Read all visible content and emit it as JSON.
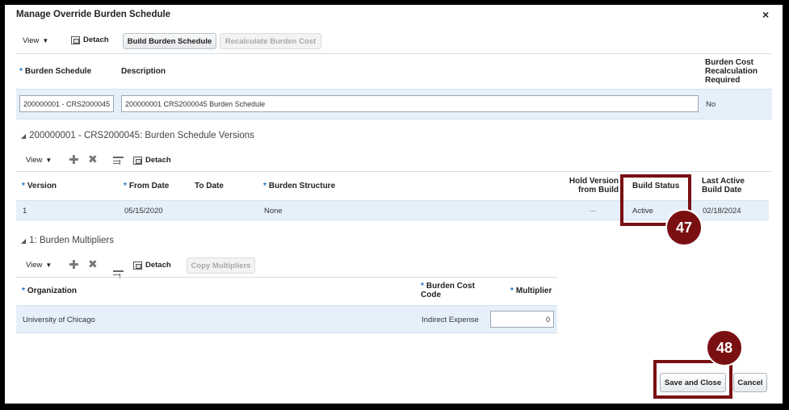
{
  "dialog": {
    "title": "Manage Override Burden Schedule",
    "close_glyph": "×"
  },
  "toolbar": {
    "view_label": "View",
    "detach_label": "Detach",
    "build_label": "Build Burden Schedule",
    "recalc_label": "Recalculate Burden Cost"
  },
  "schedule": {
    "headers": {
      "burden_schedule": "Burden Schedule",
      "description": "Description",
      "recalc": [
        "Burden Cost",
        "Recalculation",
        "Required"
      ]
    },
    "row": {
      "burden_schedule": "200000001 - CRS2000045",
      "description": "200000001 CRS2000045 Burden Schedule",
      "recalc": "No"
    }
  },
  "versions": {
    "section_title": "200000001 - CRS2000045: Burden Schedule Versions",
    "view_label": "View",
    "detach_label": "Detach",
    "headers": {
      "version": "Version",
      "from_date": "From Date",
      "to_date": "To Date",
      "burden_structure": "Burden Structure",
      "hold_version": [
        "Hold Version",
        "from Build"
      ],
      "build_status": "Build Status",
      "last_active": [
        "Last Active",
        "Build Date"
      ]
    },
    "row": {
      "version": "1",
      "from_date": "05/15/2020",
      "to_date": "",
      "burden_structure": "None",
      "hold_version": "...",
      "build_status": "Active",
      "last_active": "02/18/2024"
    }
  },
  "multipliers": {
    "section_title": "1: Burden Multipliers",
    "view_label": "View",
    "detach_label": "Detach",
    "copy_label": "Copy Multipliers",
    "headers": {
      "organization": "Organization",
      "burden_cost_code": [
        "Burden Cost",
        "Code"
      ],
      "multiplier": "Multiplier"
    },
    "row": {
      "organization": "University of Chicago",
      "burden_cost_code": "Indirect Expense",
      "multiplier": "0"
    }
  },
  "footer": {
    "save_close_label": "Save and Close",
    "cancel_label": "Cancel"
  },
  "callouts": {
    "build_status_step": "47",
    "save_step": "48"
  },
  "colors": {
    "callout": "#7a0f12",
    "row_highlight": "#e6f0fa",
    "required_marker": "#1b6ec2"
  }
}
